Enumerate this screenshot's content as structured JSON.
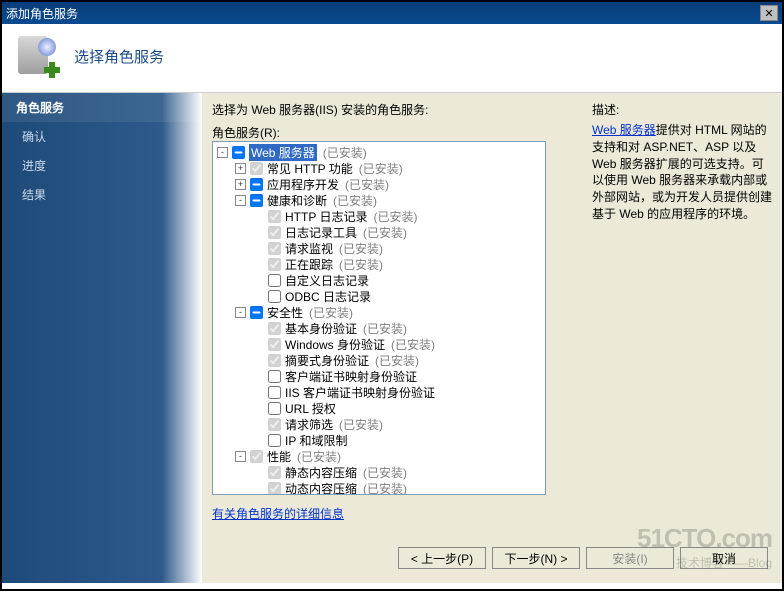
{
  "window": {
    "title": "添加角色服务"
  },
  "header": {
    "title": "选择角色服务"
  },
  "sidebar": {
    "items": [
      {
        "label": "角色服务",
        "active": true
      },
      {
        "label": "确认",
        "active": false
      },
      {
        "label": "进度",
        "active": false
      },
      {
        "label": "结果",
        "active": false
      }
    ]
  },
  "main": {
    "instruction": "选择为 Web 服务器(IIS) 安装的角色服务:",
    "roleLabel": "角色服务(R):",
    "descLabel": "描述:",
    "descLinkText": "Web 服务器",
    "descBody": "提供对 HTML 网站的支持和对 ASP.NET、ASP 以及 Web 服务器扩展的可选支持。可以使用 Web 服务器来承载内部或外部网站，或为开发人员提供创建基于 Web 的应用程序的环境。",
    "infoLink": "有关角色服务的详细信息",
    "tree": [
      {
        "depth": 0,
        "expander": "-",
        "check": "partial",
        "label": "Web 服务器",
        "installed": true,
        "selected": true
      },
      {
        "depth": 1,
        "expander": "+",
        "check": "installed",
        "label": "常见 HTTP 功能",
        "installed": true
      },
      {
        "depth": 1,
        "expander": "+",
        "check": "partial",
        "label": "应用程序开发",
        "installed": true
      },
      {
        "depth": 1,
        "expander": "-",
        "check": "partial",
        "label": "健康和诊断",
        "installed": true
      },
      {
        "depth": 2,
        "expander": "",
        "check": "installed",
        "label": "HTTP 日志记录",
        "installed": true
      },
      {
        "depth": 2,
        "expander": "",
        "check": "installed",
        "label": "日志记录工具",
        "installed": true
      },
      {
        "depth": 2,
        "expander": "",
        "check": "installed",
        "label": "请求监视",
        "installed": true
      },
      {
        "depth": 2,
        "expander": "",
        "check": "installed",
        "label": "正在跟踪",
        "installed": true
      },
      {
        "depth": 2,
        "expander": "",
        "check": "unchecked",
        "label": "自定义日志记录",
        "installed": false
      },
      {
        "depth": 2,
        "expander": "",
        "check": "unchecked",
        "label": "ODBC 日志记录",
        "installed": false
      },
      {
        "depth": 1,
        "expander": "-",
        "check": "partial",
        "label": "安全性",
        "installed": true
      },
      {
        "depth": 2,
        "expander": "",
        "check": "installed",
        "label": "基本身份验证",
        "installed": true
      },
      {
        "depth": 2,
        "expander": "",
        "check": "installed",
        "label": "Windows 身份验证",
        "installed": true
      },
      {
        "depth": 2,
        "expander": "",
        "check": "installed",
        "label": "摘要式身份验证",
        "installed": true
      },
      {
        "depth": 2,
        "expander": "",
        "check": "unchecked",
        "label": "客户端证书映射身份验证",
        "installed": false
      },
      {
        "depth": 2,
        "expander": "",
        "check": "unchecked",
        "label": "IIS 客户端证书映射身份验证",
        "installed": false
      },
      {
        "depth": 2,
        "expander": "",
        "check": "unchecked",
        "label": "URL 授权",
        "installed": false
      },
      {
        "depth": 2,
        "expander": "",
        "check": "installed",
        "label": "请求筛选",
        "installed": true
      },
      {
        "depth": 2,
        "expander": "",
        "check": "unchecked",
        "label": "IP 和域限制",
        "installed": false
      },
      {
        "depth": 1,
        "expander": "-",
        "check": "installed",
        "label": "性能",
        "installed": true
      },
      {
        "depth": 2,
        "expander": "",
        "check": "installed",
        "label": "静态内容压缩",
        "installed": true
      },
      {
        "depth": 2,
        "expander": "",
        "check": "installed",
        "label": "动态内容压缩",
        "installed": true
      }
    ]
  },
  "buttons": {
    "prev": "< 上一步(P)",
    "next": "下一步(N) >",
    "install": "安装(I)",
    "cancel": "取消"
  },
  "installedTag": "(已安装)",
  "watermark": {
    "main": "51CTO.com",
    "sub": "技术博客——Blog"
  }
}
